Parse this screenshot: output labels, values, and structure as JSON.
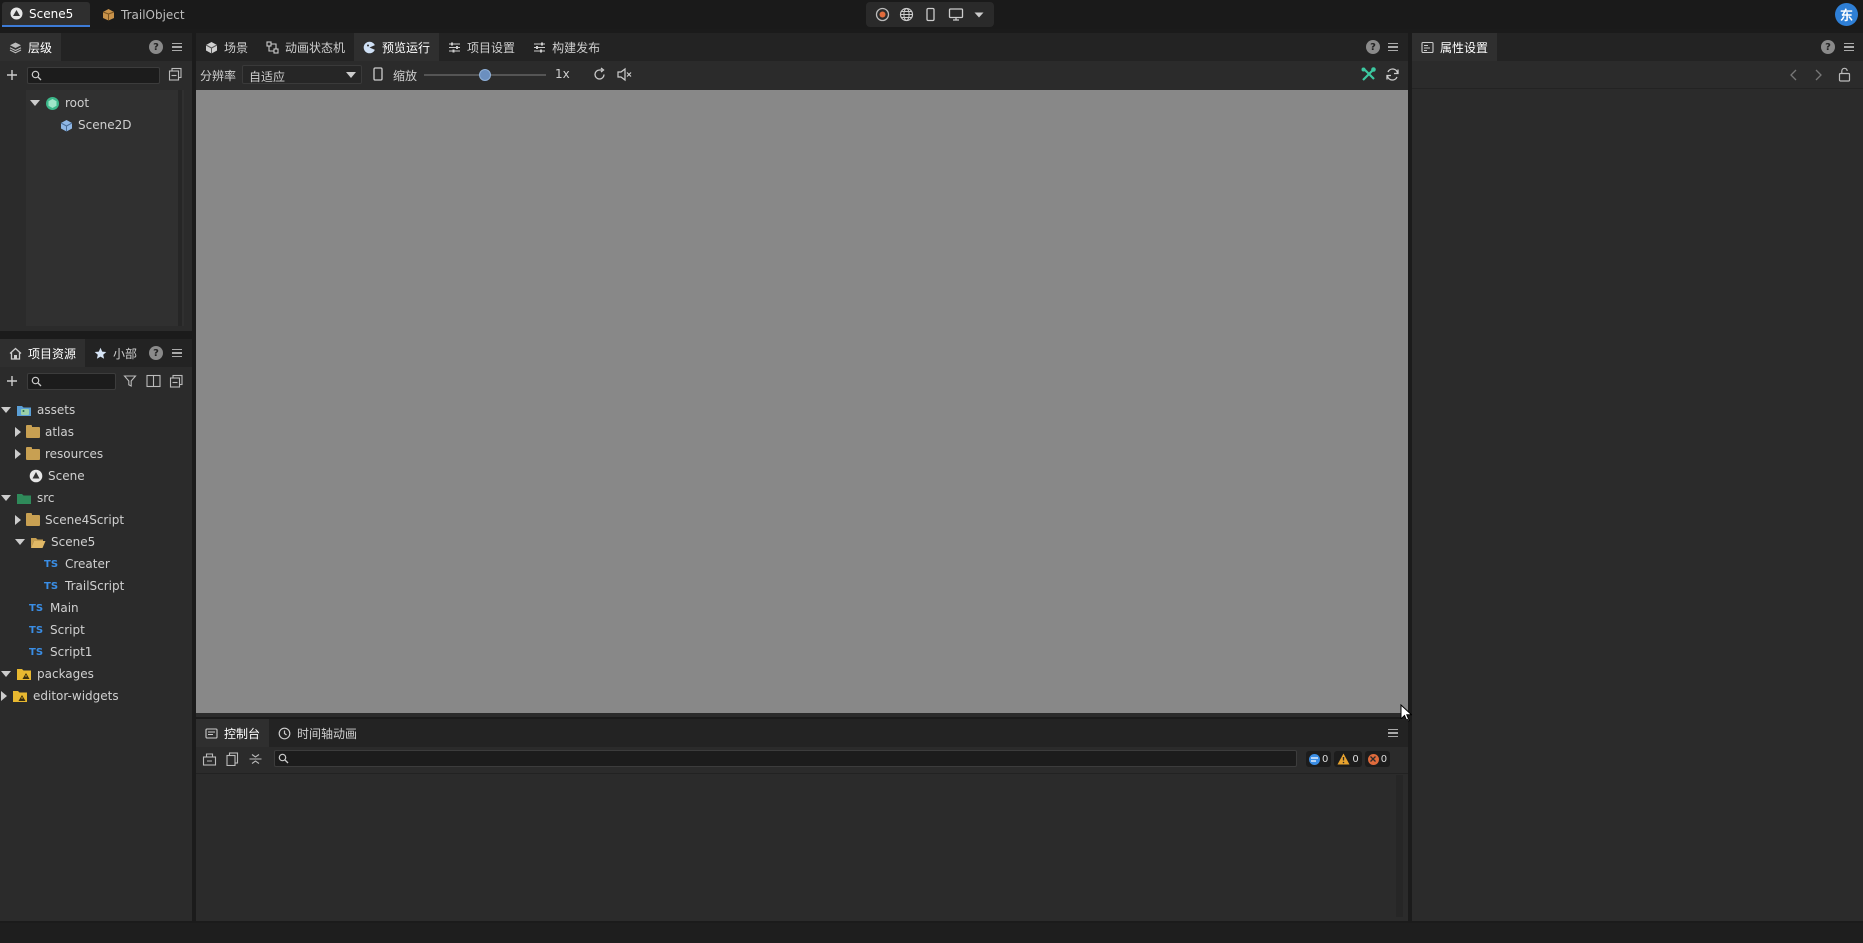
{
  "top_tabs": [
    {
      "label": "Scene5",
      "icon": "scene-icon",
      "active": true
    },
    {
      "label": "TrailObject",
      "icon": "prefab-icon",
      "active": false
    }
  ],
  "top_toolbar": {
    "icons": [
      "record-icon",
      "globe-icon",
      "phone-icon",
      "monitor-icon",
      "dropdown-icon"
    ]
  },
  "user": {
    "avatar_text": "东",
    "color": "#2e7fd6"
  },
  "hierarchy": {
    "tab_label": "层级",
    "search_placeholder": "",
    "nodes": [
      {
        "label": "root",
        "expanded": true,
        "depth": 0
      },
      {
        "label": "Scene2D",
        "depth": 1
      }
    ]
  },
  "center_tabs": [
    {
      "label": "场景",
      "icon": "scene-cube-icon",
      "active": false
    },
    {
      "label": "动画状态机",
      "icon": "state-machine-icon",
      "active": false
    },
    {
      "label": "预览运行",
      "icon": "preview-run-icon",
      "active": true
    },
    {
      "label": "项目设置",
      "icon": "settings-sliders-icon",
      "active": false
    },
    {
      "label": "构建发布",
      "icon": "build-sliders-icon",
      "active": false
    }
  ],
  "preview_toolbar": {
    "resolution_label": "分辨率",
    "resolution_value": "自适应",
    "zoom_label": "缩放",
    "zoom_value": "1x",
    "zoom_slider_position": 0.5
  },
  "viewport": {
    "background": "#888888"
  },
  "assets_panel": {
    "tabs": [
      {
        "label": "项目资源",
        "icon": "home-icon",
        "active": true
      },
      {
        "label": "小部",
        "icon": "star-icon",
        "active": false
      }
    ],
    "tree": [
      {
        "label": "assets",
        "type": "root-folder",
        "expanded": true,
        "depth": 0
      },
      {
        "label": "atlas",
        "type": "folder",
        "expanded": false,
        "depth": 1
      },
      {
        "label": "resources",
        "type": "folder",
        "expanded": false,
        "depth": 1
      },
      {
        "label": "Scene",
        "type": "scene",
        "depth": 1
      },
      {
        "label": "src",
        "type": "src-folder",
        "expanded": true,
        "depth": 0
      },
      {
        "label": "Scene4Script",
        "type": "folder",
        "expanded": false,
        "depth": 1
      },
      {
        "label": "Scene5",
        "type": "folder-open",
        "expanded": true,
        "depth": 1
      },
      {
        "label": "Creater",
        "type": "ts",
        "depth": 2
      },
      {
        "label": "TrailScript",
        "type": "ts",
        "depth": 2
      },
      {
        "label": "Main",
        "type": "ts",
        "depth": 1
      },
      {
        "label": "Script",
        "type": "ts",
        "depth": 1
      },
      {
        "label": "Script1",
        "type": "ts",
        "depth": 1
      },
      {
        "label": "packages",
        "type": "package-folder",
        "expanded": true,
        "depth": 0
      },
      {
        "label": "editor-widgets",
        "type": "package-folder",
        "expanded": false,
        "depth": 0
      }
    ]
  },
  "console": {
    "tabs": [
      {
        "label": "控制台",
        "icon": "console-icon",
        "active": true
      },
      {
        "label": "时间轴动画",
        "icon": "timeline-icon",
        "active": false
      }
    ],
    "search_placeholder": "",
    "counts": {
      "info": "0",
      "warning": "0",
      "error": "0"
    }
  },
  "properties": {
    "tab_label": "属性设置"
  },
  "colors": {
    "accent": "#3d7bd6",
    "info": "#3a8ee6",
    "warning": "#e8a32e",
    "error": "#e06b3c",
    "tool_green": "#3cc8a0"
  }
}
